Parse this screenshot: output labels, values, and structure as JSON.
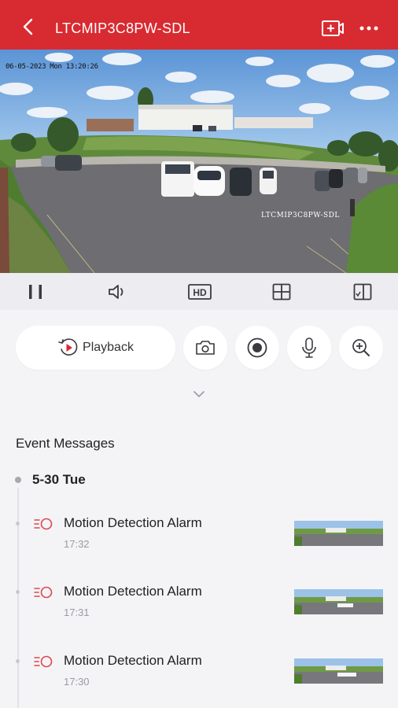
{
  "header": {
    "title": "LTCMIP3C8PW-SDL",
    "bg_color": "#d82b31"
  },
  "video": {
    "osd_timestamp": "06-05-2023 Mon 13:20:26",
    "osd_channel_name": "LTCMIP3C8PW-SDL"
  },
  "toolbar": {
    "buttons": [
      "pause-icon",
      "volume-icon",
      "hd-icon",
      "grid-icon",
      "screen-layout-icon"
    ],
    "hd_label": "HD"
  },
  "controls": {
    "playback_label": "Playback",
    "buttons": [
      "camera-icon",
      "record-icon",
      "microphone-icon",
      "zoom-in-icon"
    ]
  },
  "events": {
    "title": "Event Messages",
    "date": "5-30 Tue",
    "items": [
      {
        "name": "Motion Detection Alarm",
        "time": "17:32"
      },
      {
        "name": "Motion Detection Alarm",
        "time": "17:31"
      },
      {
        "name": "Motion Detection Alarm",
        "time": "17:30"
      }
    ]
  }
}
